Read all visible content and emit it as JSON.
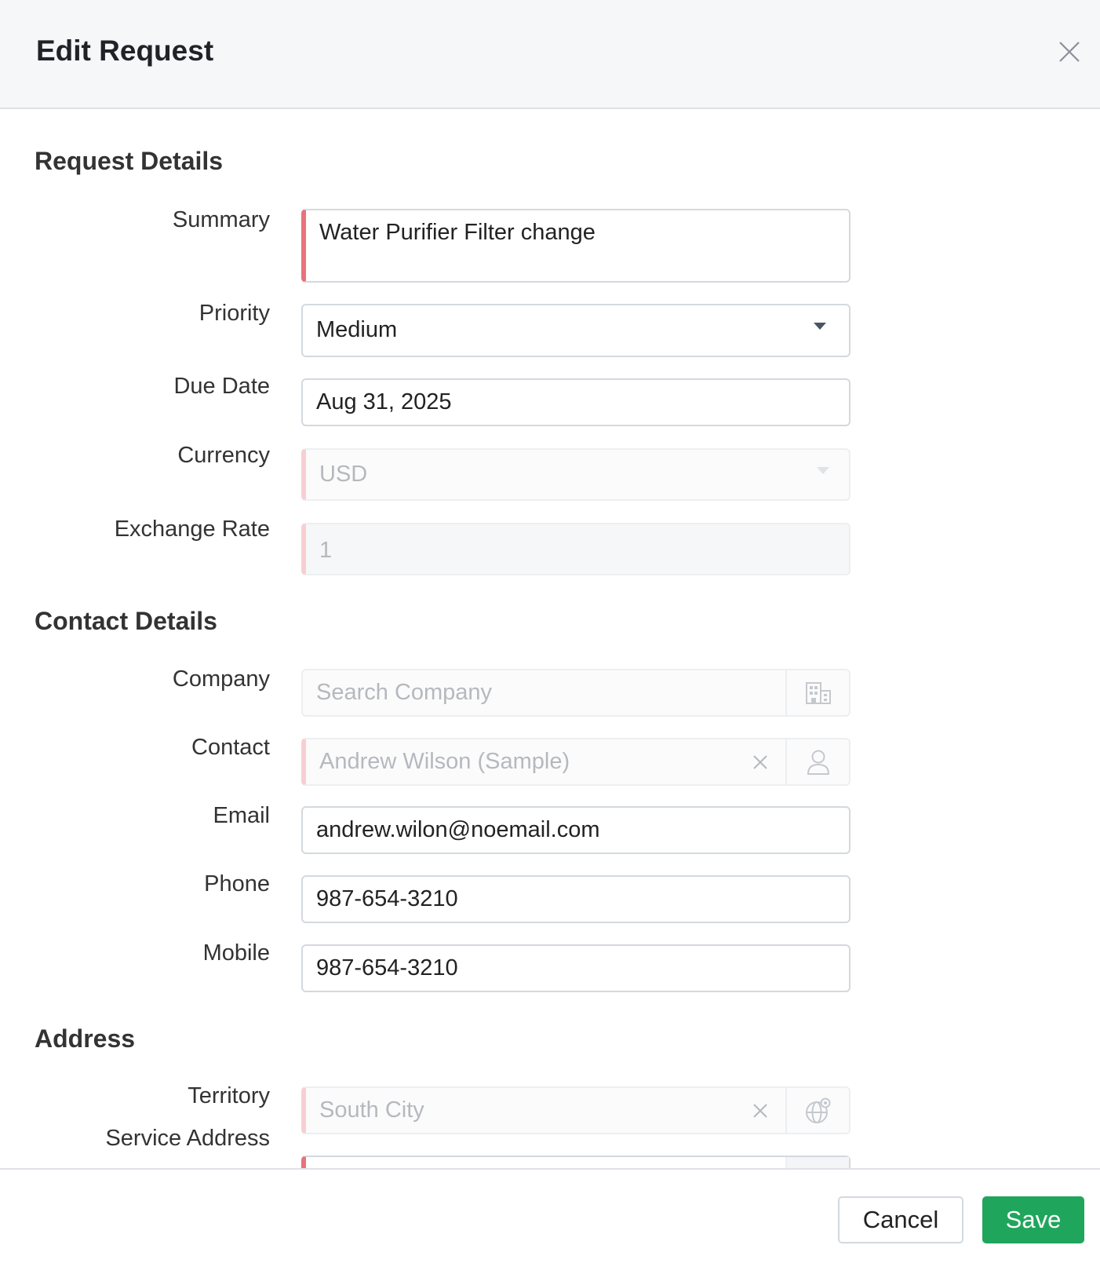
{
  "dialog": {
    "title": "Edit Request"
  },
  "sections": {
    "request": "Request Details",
    "contact": "Contact Details",
    "address": "Address"
  },
  "fields": {
    "summary": {
      "label": "Summary",
      "value": "Water Purifier Filter change"
    },
    "priority": {
      "label": "Priority",
      "value": "Medium"
    },
    "due_date": {
      "label": "Due Date",
      "value": "Aug 31, 2025"
    },
    "currency": {
      "label": "Currency",
      "value": "USD"
    },
    "exchange_rate": {
      "label": "Exchange Rate",
      "value": "1"
    },
    "company": {
      "label": "Company",
      "placeholder": "Search Company",
      "icon": "building-icon"
    },
    "contact": {
      "label": "Contact",
      "value": "Andrew Wilson (Sample)",
      "icon": "user-icon"
    },
    "email": {
      "label": "Email",
      "value": "andrew.wilon@noemail.com"
    },
    "phone": {
      "label": "Phone",
      "value": "987-654-3210"
    },
    "mobile": {
      "label": "Mobile",
      "value": "987-654-3210"
    },
    "territory": {
      "label": "Territory",
      "value": "South City",
      "icon": "globe-pin-icon"
    },
    "service_address": {
      "label": "Service Address"
    }
  },
  "footer": {
    "cancel_label": "Cancel",
    "save_label": "Save"
  },
  "colors": {
    "required_marker": "#e8737a",
    "save_button": "#1fa65c",
    "header_bg": "#f5f7f9"
  }
}
